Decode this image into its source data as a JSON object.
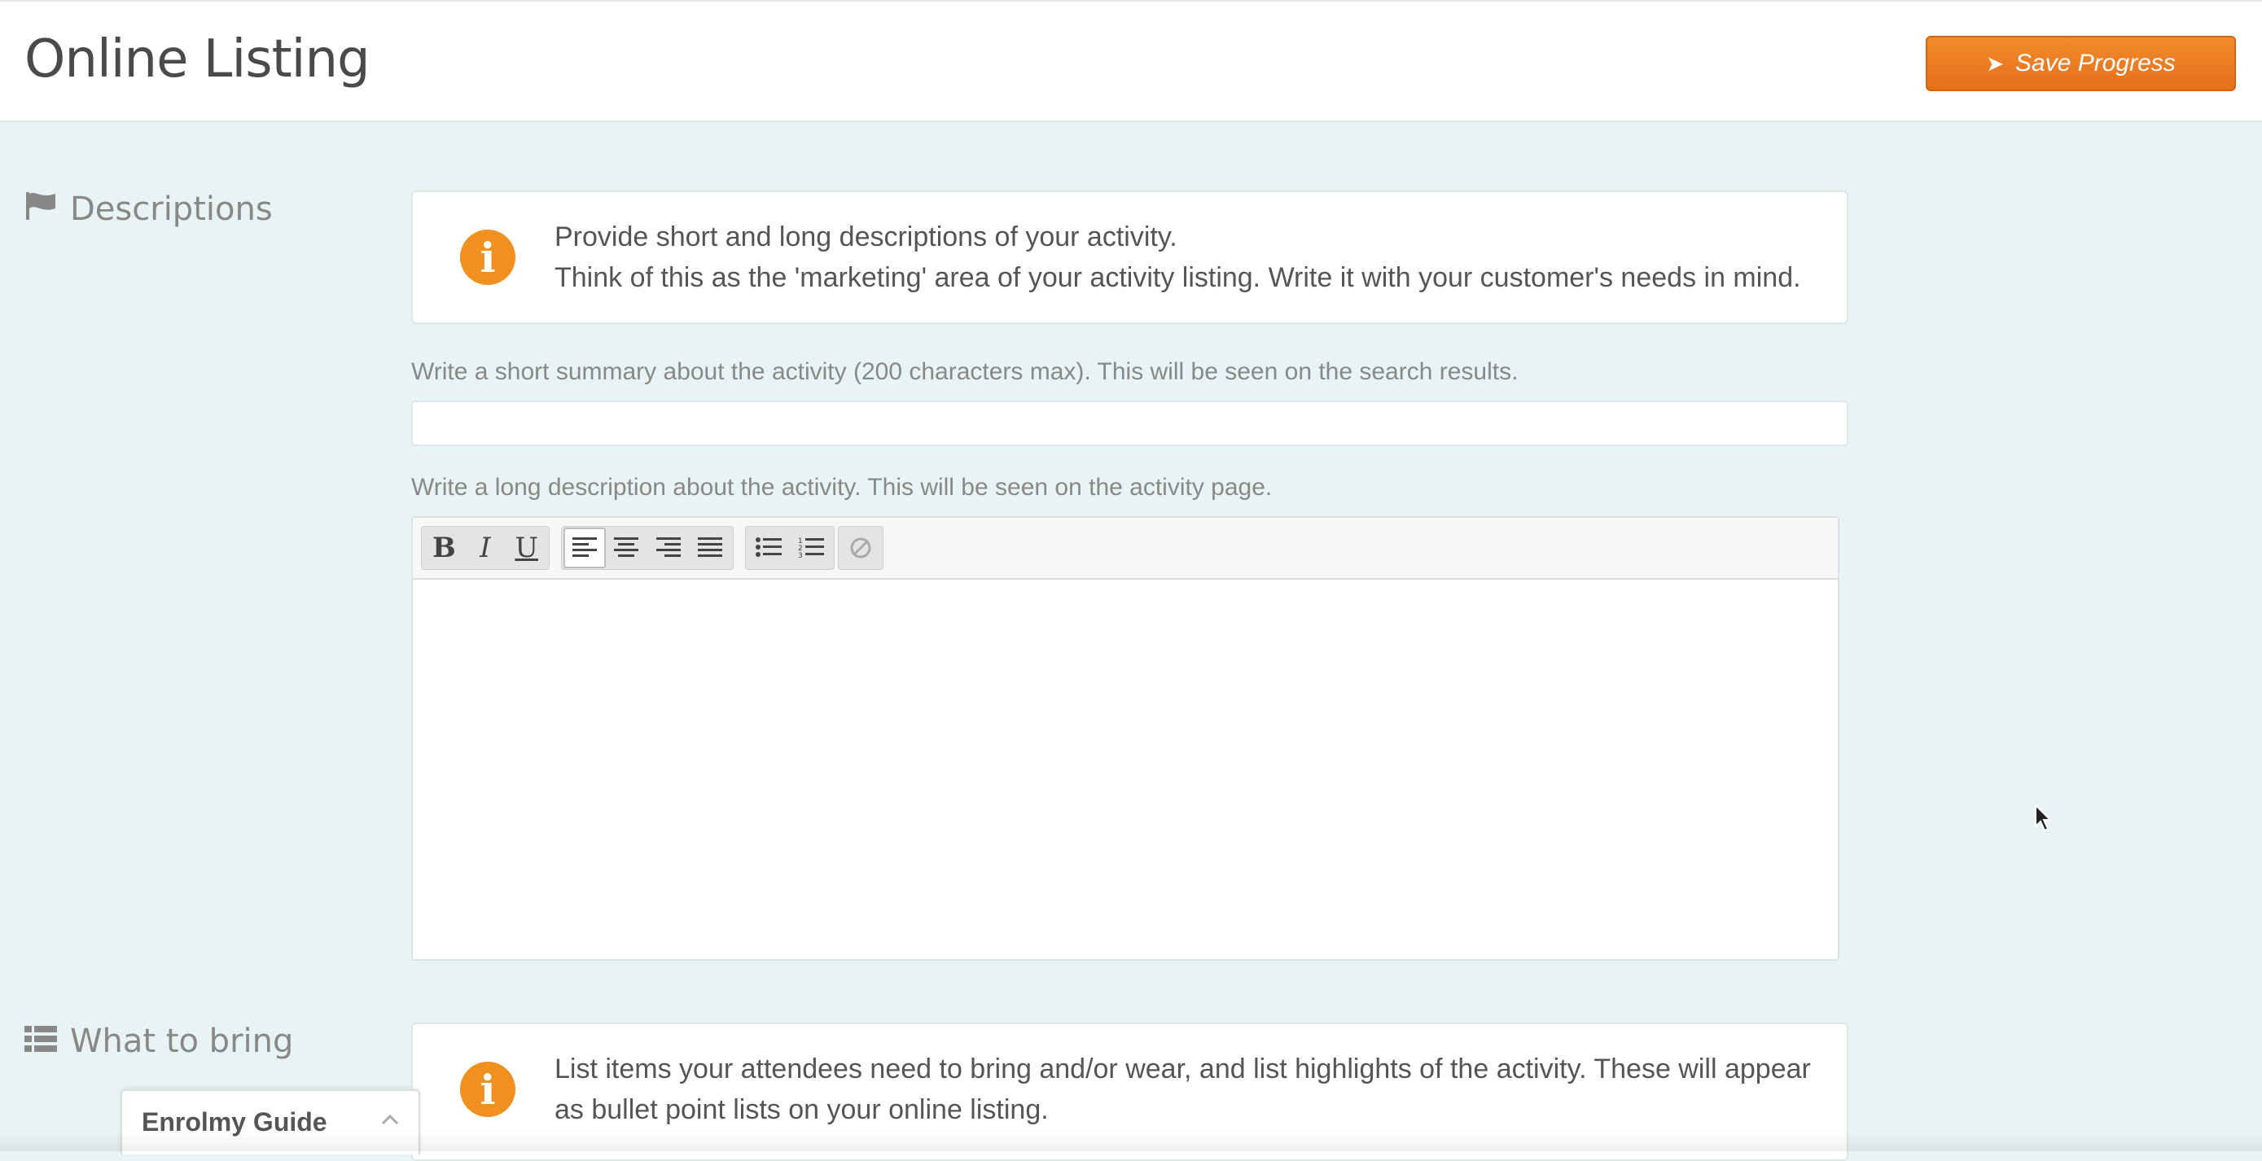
{
  "header": {
    "title": "Online Listing",
    "save_button": "Save Progress"
  },
  "sections": {
    "descriptions": {
      "label": "Descriptions",
      "info_line1": "Provide short and long descriptions of your activity.",
      "info_line2": "Think of this as the 'marketing' area of your activity listing. Write it with your customer's needs in mind.",
      "short_label": "Write a short summary about the activity (200 characters max). This will be seen on the search results.",
      "short_value": "",
      "long_label": "Write a long description about the activity. This will be seen on the activity page.",
      "long_value": ""
    },
    "what_to_bring": {
      "label": "What to bring",
      "info_text": "List items your attendees need to bring and/or wear, and list highlights of the activity. These will appear as bullet point lists on your online listing."
    }
  },
  "editor_toolbar": {
    "bold": "B",
    "italic": "I",
    "underline": "U",
    "icons": [
      "align-left-icon",
      "align-center-icon",
      "align-right-icon",
      "align-justify-icon",
      "bullet-list-icon",
      "numbered-list-icon",
      "clear-format-icon"
    ]
  },
  "guide": {
    "title": "Enrolmy Guide"
  },
  "colors": {
    "accent": "#f0911f",
    "button": "#e97820",
    "background": "#e8f4f3"
  }
}
